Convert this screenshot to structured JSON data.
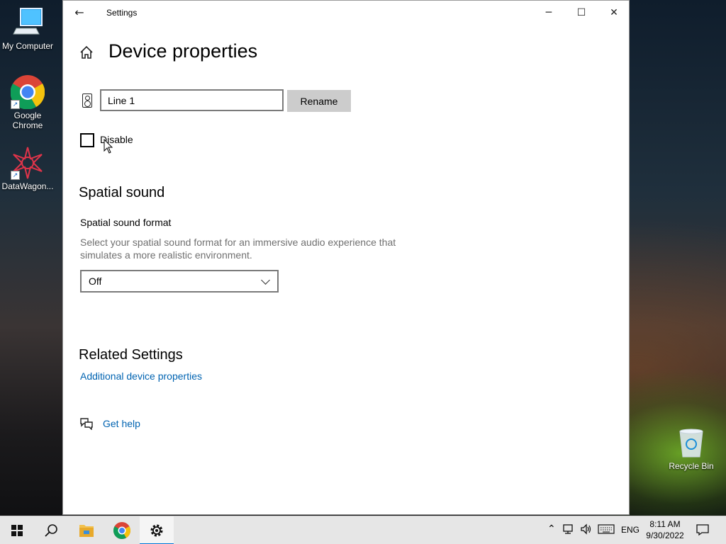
{
  "desktop": {
    "icons": [
      {
        "label": "My Computer"
      },
      {
        "label": "Google Chrome"
      },
      {
        "label": "DataWagon..."
      }
    ],
    "recycle_bin": {
      "label": "Recycle Bin"
    }
  },
  "window": {
    "title": "Settings",
    "back_icon": "←",
    "minimize": "─",
    "maximize": "☐",
    "close": "✕"
  },
  "page": {
    "title": "Device properties",
    "device_name_value": "Line 1",
    "rename_label": "Rename",
    "disable_label": "Disable",
    "disable_checked": false
  },
  "spatial": {
    "heading": "Spatial sound",
    "format_label": "Spatial sound format",
    "description": "Select your spatial sound format for an immersive audio experience that simulates a more realistic environment.",
    "selected": "Off"
  },
  "related": {
    "heading": "Related Settings",
    "link": "Additional device properties"
  },
  "help": {
    "label": "Get help"
  },
  "taskbar": {
    "language": "ENG",
    "time": "8:11 AM",
    "date": "9/30/2022"
  },
  "colors": {
    "accent": "#0078d7",
    "link": "#0063b1",
    "muted_text": "#707070"
  }
}
